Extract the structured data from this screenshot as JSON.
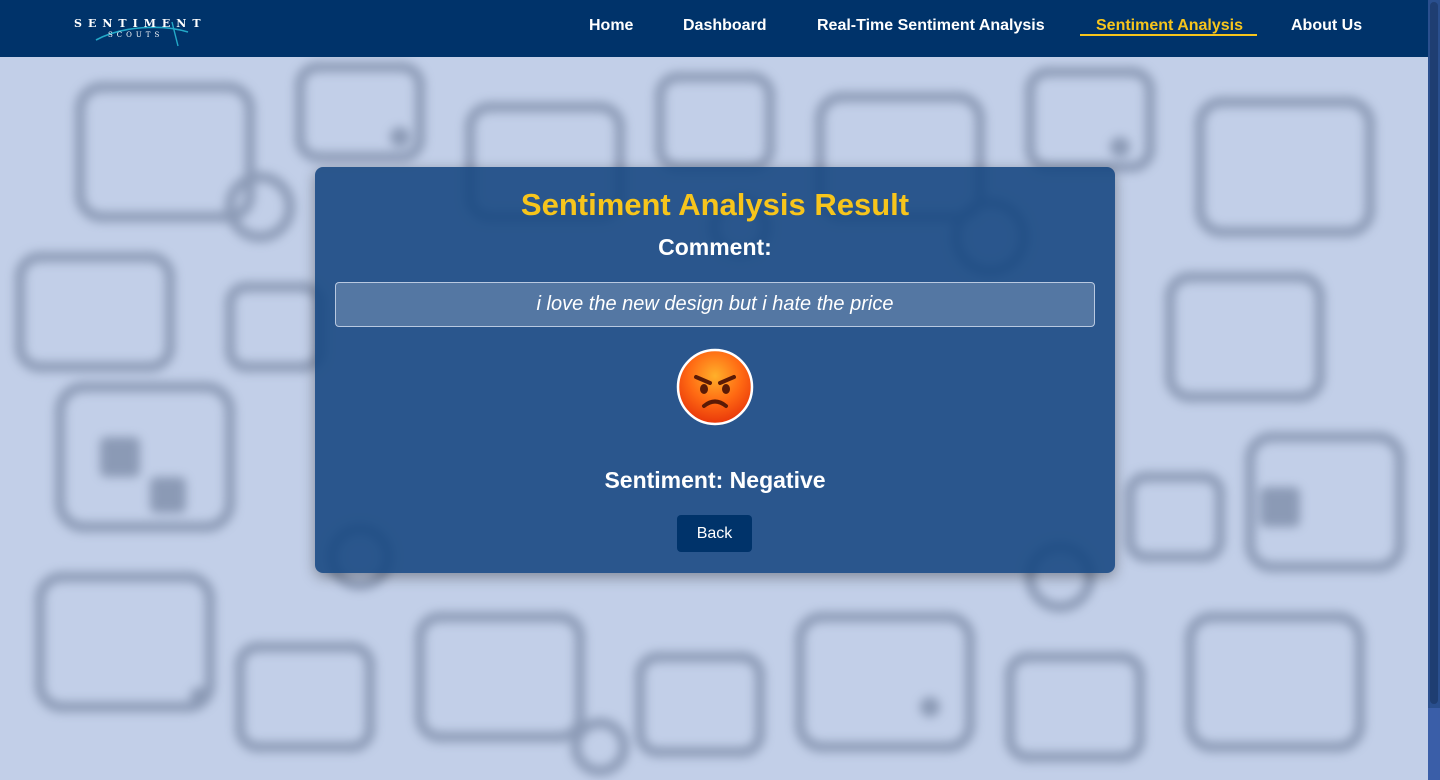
{
  "navbar": {
    "logo": {
      "line1": "SENTIMENT",
      "line2": "SCOUTS"
    },
    "links": [
      {
        "label": "Home"
      },
      {
        "label": "Dashboard"
      },
      {
        "label": "Real-Time Sentiment Analysis"
      },
      {
        "label": "Sentiment Analysis"
      },
      {
        "label": "About Us"
      }
    ],
    "active_link": "Sentiment Analysis"
  },
  "result": {
    "title": "Sentiment Analysis Result",
    "comment_label": "Comment:",
    "comment_text": "i love the new design but i hate the price",
    "sentiment_emoji": "angry-face-icon",
    "sentiment_label": "Sentiment:",
    "sentiment_value": "Negative",
    "sentiment_line": "Sentiment: Negative",
    "back_label": "Back"
  },
  "colors": {
    "navbar_bg": "#00336a",
    "accent": "#f7c51c",
    "card_bg": "#1d4f86",
    "page_bg": "#c4d0e9"
  }
}
